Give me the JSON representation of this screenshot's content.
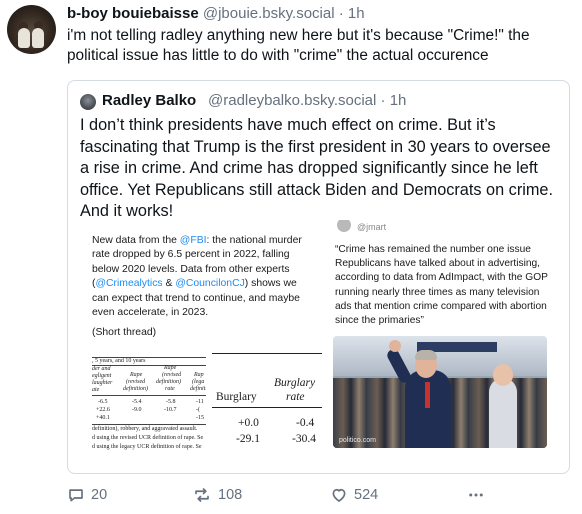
{
  "post": {
    "display_name": "b-boy bouiebaisse",
    "handle": "@jbouie.bsky.social",
    "separator": "·",
    "time": "1h",
    "text": "i'm not telling radley anything new here but it's because \"Crime!\" the political issue has little to do with \"crime\" the actual occurence"
  },
  "quote": {
    "display_name": "Radley Balko",
    "handle": "@radleybalko.bsky.social",
    "separator": "·",
    "time": "1h",
    "text": "I don’t think presidents have much effect on crime. But it’s fascinating that Trump is the first president in 30 years to oversee a rise in crime. And crime has dropped significantly since he left office. Yet Republicans still attack Biden and Democrats on crime. And it works!"
  },
  "image_left": {
    "news_part1": "New data from the ",
    "news_link1": "@FBI",
    "news_part2": ": the national murder rate dropped by 6.5 percent in 2022, falling below 2020 levels. Data from other experts (",
    "news_link2": "@Crimealytics",
    "news_part3": " & ",
    "news_link3": "@CouncilonCJ",
    "news_part4": ") shows we can expect that trend to continue, and maybe even accelerate, in 2023.",
    "thread_label": "(Short thread)",
    "small_table": {
      "title": ", 5 years, and 10 years",
      "h1": "der and",
      "h2": "egligent",
      "h3": "laughter",
      "h4": "ate",
      "c1": "Rape",
      "c1b": "(revised",
      "c1c": "definition)",
      "c2": "Rape",
      "c2b": "(revised",
      "c2c": "definition)",
      "c2d": "rate",
      "c3": "Rap",
      "c3b": "(lega",
      "c3c": "definiti",
      "r1": [
        "-6.5",
        "-5.4",
        "-5.8",
        "-11"
      ],
      "r2": [
        "+22.6",
        "-9.0",
        "-10.7",
        "-("
      ],
      "r3": [
        "+40.1",
        "",
        "",
        "-15"
      ],
      "foot1": "definition), robbery, and aggravated assault.",
      "foot2": "d using the revised UCR definition of rape. Se",
      "foot3": "d using the legacy UCR definition of rape. Se"
    },
    "big_table": {
      "col1": "Burglary",
      "col2a": "Burglary",
      "col2b": "rate",
      "row1": [
        "+0.0",
        "-0.4"
      ],
      "row2": [
        "-29.1",
        "-30.4"
      ]
    }
  },
  "image_right": {
    "handle": "@jmart",
    "quote": "“Crime has remained the number one issue Republicans have talked about in advertising, according to data from AdImpact, with the GOP running nearly three times as many television ads that mention crime compared with abortion since the primaries”",
    "photo_watermark": "politico.com"
  },
  "actions": {
    "reply_count": "20",
    "repost_count": "108",
    "like_count": "524",
    "reply_icon": "comment-icon",
    "repost_icon": "repost-icon",
    "like_icon": "heart-icon",
    "more_icon": "ellipsis-icon"
  },
  "colors": {
    "link": "#1d8bf0",
    "muted": "#66717f",
    "text": "#0f1419",
    "border": "#d4dbe2"
  }
}
